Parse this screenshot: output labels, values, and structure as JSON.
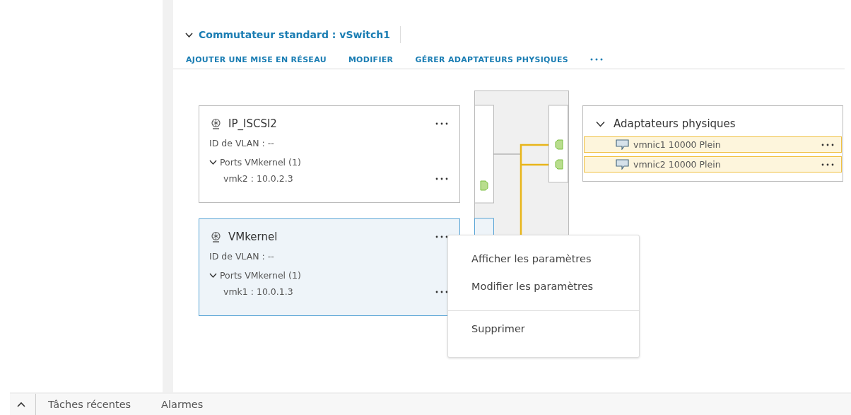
{
  "switch": {
    "title": "Commutateur standard : vSwitch1",
    "expanded": true
  },
  "toolbar": [
    "AJOUTER UNE MISE EN RÉSEAU",
    "MODIFIER",
    "GÉRER ADAPTATEURS PHYSIQUES"
  ],
  "port_groups": [
    {
      "name": "IP_ISCSI2",
      "selected": false,
      "vlan": "ID de VLAN : --",
      "ports_label": "Ports VMkernel (1)",
      "expanded": true,
      "ports": [
        "vmk2 : 10.0.2.3"
      ]
    },
    {
      "name": "VMkernel",
      "selected": true,
      "vlan": "ID de VLAN : --",
      "ports_label": "Ports VMkernel (1)",
      "expanded": true,
      "ports": [
        "vmk1 : 10.0.1.3"
      ]
    }
  ],
  "adapters": {
    "title": "Adaptateurs physiques",
    "expanded": true,
    "items": [
      {
        "label": "vmnic1 10000 Plein"
      },
      {
        "label": "vmnic2 10000 Plein"
      }
    ]
  },
  "context_menu": {
    "items": [
      {
        "kind": "item",
        "label": "Afficher les paramètres"
      },
      {
        "kind": "item",
        "label": "Modifier les paramètres"
      },
      {
        "kind": "divider"
      },
      {
        "kind": "item",
        "label": "Supprimer"
      }
    ]
  },
  "bottom_bar": {
    "tabs": [
      "Tâches récentes",
      "Alarmes"
    ]
  }
}
